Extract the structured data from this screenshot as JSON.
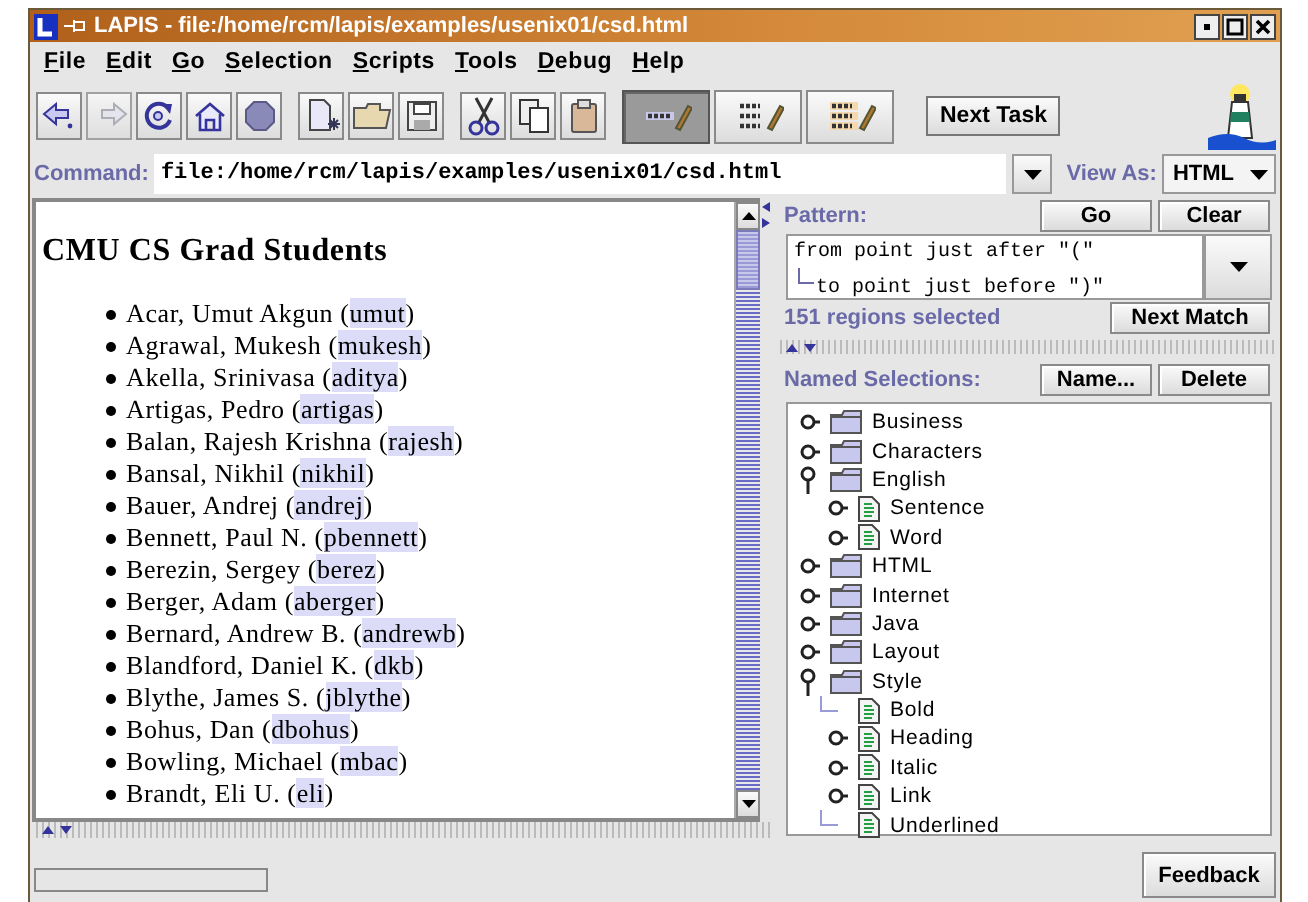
{
  "window": {
    "title": "LAPIS - file:/home/rcm/lapis/examples/usenix01/csd.html"
  },
  "menu": [
    {
      "label": "File"
    },
    {
      "label": "Edit"
    },
    {
      "label": "Go"
    },
    {
      "label": "Selection"
    },
    {
      "label": "Scripts"
    },
    {
      "label": "Tools"
    },
    {
      "label": "Debug"
    },
    {
      "label": "Help"
    }
  ],
  "toolbar": {
    "groups": [
      [
        {
          "kind": "back",
          "disabled": false
        },
        {
          "kind": "forward",
          "disabled": true
        },
        {
          "kind": "reload",
          "disabled": false
        },
        {
          "kind": "home",
          "disabled": false
        },
        {
          "kind": "stop",
          "disabled": false
        }
      ],
      [
        {
          "kind": "new",
          "disabled": false
        },
        {
          "kind": "open",
          "disabled": false
        },
        {
          "kind": "save",
          "disabled": false
        }
      ],
      [
        {
          "kind": "cut",
          "disabled": false
        },
        {
          "kind": "copy",
          "disabled": false
        },
        {
          "kind": "paste",
          "disabled": false
        }
      ],
      [
        {
          "kind": "mode-single",
          "selected": true
        },
        {
          "kind": "mode-multi",
          "selected": false
        },
        {
          "kind": "mode-multi-tinted",
          "selected": false
        }
      ]
    ],
    "next_task": "Next Task"
  },
  "command": {
    "label": "Command:",
    "value": "file:/home/rcm/lapis/examples/usenix01/csd.html",
    "view_as_label": "View As:",
    "view_as_value": "HTML"
  },
  "document": {
    "heading": "CMU CS Grad Students",
    "items": [
      {
        "before": "Acar, Umut Akgun (",
        "match": "umut",
        "after": ")"
      },
      {
        "before": "Agrawal, Mukesh (",
        "match": "mukesh",
        "after": ")"
      },
      {
        "before": "Akella, Srinivasa (",
        "match": "aditya",
        "after": ")"
      },
      {
        "before": "Artigas, Pedro (",
        "match": "artigas",
        "after": ")"
      },
      {
        "before": "Balan, Rajesh Krishna (",
        "match": "rajesh",
        "after": ")"
      },
      {
        "before": "Bansal, Nikhil (",
        "match": "nikhil",
        "after": ")"
      },
      {
        "before": "Bauer, Andrej (",
        "match": "andrej",
        "after": ")"
      },
      {
        "before": "Bennett, Paul N. (",
        "match": "pbennett",
        "after": ")"
      },
      {
        "before": "Berezin, Sergey (",
        "match": "berez",
        "after": ")"
      },
      {
        "before": "Berger, Adam (",
        "match": "aberger",
        "after": ")"
      },
      {
        "before": "Bernard, Andrew B. (",
        "match": "andrewb",
        "after": ")"
      },
      {
        "before": "Blandford, Daniel K. (",
        "match": "dkb",
        "after": ")"
      },
      {
        "before": "Blythe, James S. (",
        "match": "jblythe",
        "after": ")"
      },
      {
        "before": "Bohus, Dan (",
        "match": "dbohus",
        "after": ")"
      },
      {
        "before": "Bowling, Michael (",
        "match": "mbac",
        "after": ")"
      },
      {
        "before": "Brandt, Eli U. (",
        "match": "eli",
        "after": ")"
      }
    ]
  },
  "pattern": {
    "label": "Pattern:",
    "buttons": [
      "Go",
      "Clear"
    ],
    "lines": [
      "from point just after \"(\"",
      "to point just before \")\""
    ],
    "status": "151 regions selected",
    "next_match": "Next Match"
  },
  "named_selections": {
    "label": "Named Selections:",
    "buttons": [
      "Name...",
      "Delete"
    ],
    "tree": [
      {
        "label": "Business",
        "kind": "folder",
        "expanded": false
      },
      {
        "label": "Characters",
        "kind": "folder",
        "expanded": false
      },
      {
        "label": "English",
        "kind": "folder",
        "expanded": true,
        "children": [
          {
            "label": "Sentence",
            "kind": "pattern",
            "expanded": false
          },
          {
            "label": "Word",
            "kind": "pattern",
            "expanded": false
          }
        ]
      },
      {
        "label": "HTML",
        "kind": "folder",
        "expanded": false
      },
      {
        "label": "Internet",
        "kind": "folder",
        "expanded": false
      },
      {
        "label": "Java",
        "kind": "folder",
        "expanded": false
      },
      {
        "label": "Layout",
        "kind": "folder",
        "expanded": false
      },
      {
        "label": "Style",
        "kind": "folder",
        "expanded": true,
        "children": [
          {
            "label": "Bold",
            "kind": "pattern"
          },
          {
            "label": "Heading",
            "kind": "pattern",
            "expanded": false
          },
          {
            "label": "Italic",
            "kind": "pattern",
            "expanded": false
          },
          {
            "label": "Link",
            "kind": "pattern",
            "expanded": false
          },
          {
            "label": "Underlined",
            "kind": "pattern"
          }
        ]
      }
    ]
  },
  "status_bar": {
    "feedback": "Feedback"
  }
}
